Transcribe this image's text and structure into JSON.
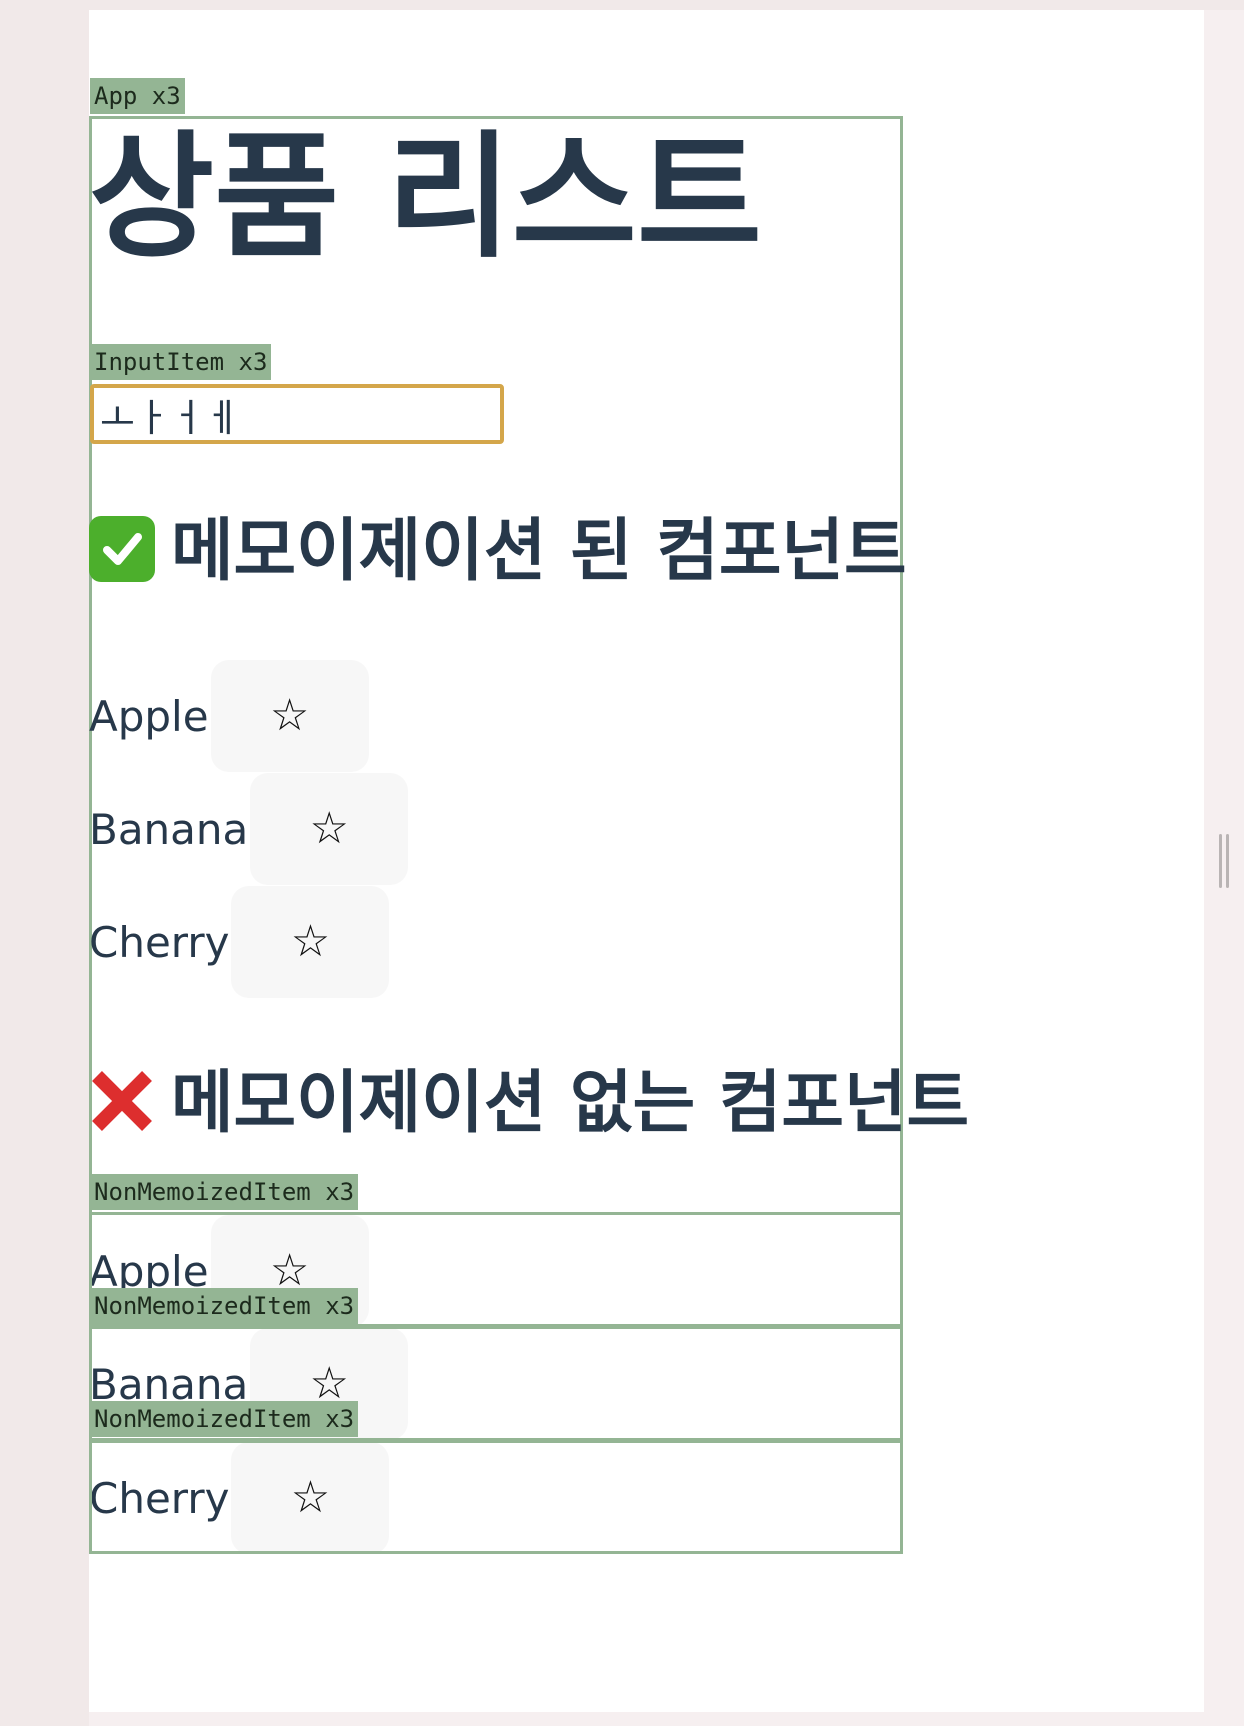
{
  "app_tag": "App x3",
  "title": "상품 리스트",
  "input_tag": "InputItem x3",
  "input_value": "ㅗㅏㅓㅔ",
  "memoized_heading": "메모이제이션 된 컴포넌트",
  "non_memoized_heading": "메모이제이션 없는 컴포넌트",
  "memoized_items": [
    {
      "label": "Apple",
      "star": "☆"
    },
    {
      "label": "Banana",
      "star": "☆"
    },
    {
      "label": "Cherry",
      "star": "☆"
    }
  ],
  "non_memoized_tag": "NonMemoizedItem x3",
  "non_memoized_items": [
    {
      "label": "Apple",
      "star": "☆"
    },
    {
      "label": "Banana",
      "star": "☆"
    },
    {
      "label": "Cherry",
      "star": "☆"
    }
  ],
  "colors": {
    "highlight_tag": "#94b594",
    "text": "#27384a",
    "input_border": "#d4a64a"
  },
  "icons": [
    "check-mark-icon",
    "cross-mark-icon",
    "star-icon"
  ]
}
